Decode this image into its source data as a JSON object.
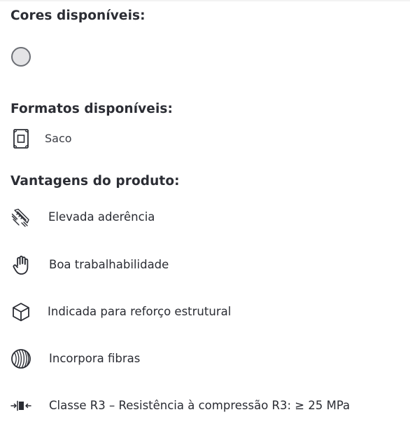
{
  "colors": {
    "title": "Cores disponíveis:",
    "swatches": [
      {
        "name": "cinzento",
        "hex": "#e4e4e6"
      }
    ]
  },
  "formats": {
    "title": "Formatos disponíveis:",
    "items": [
      {
        "label": "Saco",
        "icon": "bag-icon"
      }
    ]
  },
  "advantages": {
    "title": "Vantagens do produto:",
    "items": [
      {
        "label": "Elevada aderência",
        "icon": "adhesion-trowel-icon"
      },
      {
        "label": "Boa trabalhabilidade",
        "icon": "hand-icon"
      },
      {
        "label": "Indicada para reforço estrutural",
        "icon": "cube-icon"
      },
      {
        "label": "Incorpora fibras",
        "icon": "fibers-icon"
      },
      {
        "label": "Classe R3 – Resistência à compressão R3: ≥ 25 MPa",
        "icon": "compression-icon"
      }
    ]
  }
}
